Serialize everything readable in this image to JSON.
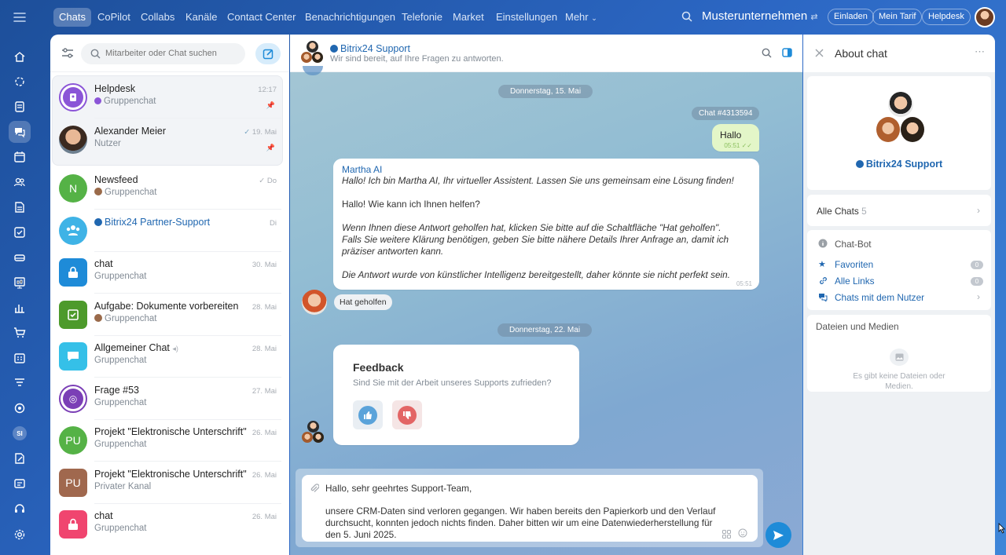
{
  "nav": {
    "tabs": [
      "Chats",
      "CoPilot",
      "Collabs",
      "Kanäle",
      "Contact Center",
      "Benachrichtigungen",
      "Telefonie",
      "Market",
      "Einstellungen",
      "Mehr"
    ],
    "company": "Musterunternehmen",
    "buttons": {
      "invite": "Einladen",
      "plan": "Mein Tarif",
      "helpdesk": "Helpdesk"
    },
    "rail_user_initials": "SI"
  },
  "chatlist": {
    "search_placeholder": "Mitarbeiter oder Chat suchen",
    "items": [
      {
        "name": "Helpdesk",
        "sub": "Gruppenchat",
        "time": "12:17",
        "pinned": true
      },
      {
        "name": "Alexander Meier",
        "sub": "Nutzer",
        "time": "19. Mai",
        "pinned": true
      },
      {
        "name": "Newsfeed",
        "sub": "Gruppenchat",
        "time": "Do",
        "initial": "N"
      },
      {
        "name": "Bitrix24 Partner-Support",
        "sub": "",
        "time": "Di"
      },
      {
        "name": "chat",
        "sub": "Gruppenchat",
        "time": "30. Mai"
      },
      {
        "name": "Aufgabe: Dokumente vorbereiten",
        "sub": "Gruppenchat",
        "time": "28. Mai"
      },
      {
        "name": "Allgemeiner Chat",
        "sub": "Gruppenchat",
        "time": "28. Mai"
      },
      {
        "name": "Frage #53",
        "sub": "Gruppenchat",
        "time": "27. Mai"
      },
      {
        "name": "Projekt \"Elektronische Unterschrift\"",
        "sub": "Gruppenchat",
        "time": "26. Mai",
        "initial": "PU"
      },
      {
        "name": "Projekt \"Elektronische Unterschrift\"",
        "sub": "Privater Kanal",
        "time": "26. Mai",
        "initial": "PU"
      },
      {
        "name": "chat",
        "sub": "Gruppenchat",
        "time": "26. Mai"
      }
    ]
  },
  "chat": {
    "title": "Bitrix24 Support",
    "subtitle": "Wir sind bereit, auf Ihre Fragen zu antworten.",
    "date1": "Donnerstag, 15. Mai",
    "chat_id": "Chat #4313594",
    "user_msg": {
      "text": "Hallo",
      "time": "05:51"
    },
    "bot_msg": {
      "author": "Martha AI",
      "line1": "Hallo! Ich bin Martha AI, Ihr virtueller Assistent. Lassen Sie uns gemeinsam eine Lösung finden!",
      "line2": "Hallo! Wie kann ich Ihnen helfen?",
      "line3a": "Wenn Ihnen diese Antwort geholfen hat, klicken Sie bitte auf die Schaltfläche \"Hat geholfen\".",
      "line3b": "Falls Sie weitere Klärung benötigen, geben Sie bitte nähere Details Ihrer Anfrage an, damit ich",
      "line3c": "präziser antworten kann.",
      "line4": "Die Antwort wurde von künstlicher Intelligenz bereitgestellt, daher könnte sie nicht perfekt sein.",
      "time": "05:51"
    },
    "helped_label": "Hat geholfen",
    "date2": "Donnerstag, 22. Mai",
    "feedback": {
      "title": "Feedback",
      "question": "Sind Sie mit der Arbeit unseres Supports zufrieden?"
    },
    "composer": {
      "line1": "Hallo, sehr geehrtes Support-Team,",
      "line2": "unsere CRM-Daten sind verloren gegangen. Wir haben bereits den Papierkorb und den Verlauf",
      "line3": "durchsucht, konnten jedoch nichts finden. Daher bitten wir um eine Datenwiederherstellung für",
      "line4": "den 5. Juni 2025."
    }
  },
  "about": {
    "title": "About chat",
    "name": "Bitrix24 Support",
    "all_chats_label": "Alle Chats",
    "all_chats_count": "5",
    "chatbot_label": "Chat-Bot",
    "favorites_label": "Favoriten",
    "favorites_count": "0",
    "links_label": "Alle Links",
    "links_count": "0",
    "chats_with_user_label": "Chats mit dem Nutzer",
    "files_title": "Dateien und Medien",
    "files_empty_1": "Es gibt keine Dateien oder",
    "files_empty_2": "Medien."
  },
  "colors": {
    "accent": "#2fc6f6",
    "link": "#2067b0",
    "user_bubble": "#e3f6c8",
    "like": "#5aa3da",
    "dislike": "#e36565"
  }
}
